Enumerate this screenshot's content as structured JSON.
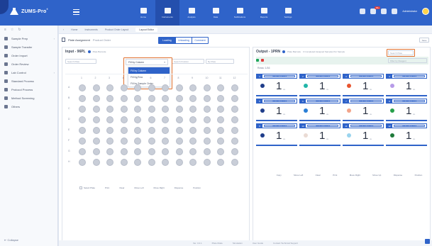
{
  "app": {
    "title": "ZUMS-Pro",
    "title_sup": "®",
    "brand_color": "#2f63c9",
    "icon": "flask-logo-icon"
  },
  "topnav": {
    "items": [
      {
        "label": "Home"
      },
      {
        "label": "Instruments"
      },
      {
        "label": "Analysis"
      },
      {
        "label": "Data"
      },
      {
        "label": "Notifications"
      },
      {
        "label": "Reports"
      },
      {
        "label": "Settings"
      }
    ],
    "active_index": 1,
    "notification_count": "99+",
    "user": "Administrator"
  },
  "sidebar": {
    "items": [
      {
        "label": "Sample Prep",
        "icon": "sample-icon"
      },
      {
        "label": "Sample Transfer"
      },
      {
        "label": "Order Import"
      },
      {
        "label": "Order Review"
      },
      {
        "label": "Lab Control"
      },
      {
        "label": "Standard Process"
      },
      {
        "label": "Protocol Process"
      },
      {
        "label": "Method Screening"
      },
      {
        "label": "Others"
      }
    ],
    "footer": "Collapse"
  },
  "breadcrumb": [
    "Home",
    "Instruments",
    "Product Order Layout",
    "Layout Editor"
  ],
  "toolbar": {
    "title": "Plate Assignment",
    "title_suffix": "Product Order",
    "seg_options": [
      "Loading",
      "Unloading",
      "Comment"
    ],
    "seg_active": 0,
    "save_label": "Save"
  },
  "input_panel": {
    "title": "Input - 96PL",
    "subtitle": "Plate Barcode",
    "filter_placeholder": "Search Plate",
    "filter2_placeholder": "Search Position",
    "filter3_placeholder": "By Plate",
    "dropdown": {
      "current": "Fill by Column",
      "options": [
        "Fill by Column",
        "Fill by Row",
        "Fill by Sample Order"
      ],
      "selected_index": 0
    },
    "columns": [
      "1",
      "2",
      "3",
      "4",
      "5",
      "6",
      "7",
      "8",
      "9",
      "10",
      "11",
      "12"
    ],
    "rows": [
      "A",
      "B",
      "C",
      "D",
      "E",
      "F",
      "G",
      "H"
    ],
    "footer": [
      "Select Plate",
      "Print",
      "Clear",
      "Move Left",
      "Move Right",
      "Dispense",
      "Position"
    ]
  },
  "output_panel": {
    "title": "Output - 1PRN",
    "subtitle": "Plate Barcode",
    "assigned_text": "3 Completed Assigned Samples Per Sample",
    "filter_placeholder": "Search Plate",
    "filter2_placeholder": "Filter by Reagent",
    "rows_label": "Rows: 1/16",
    "legend_colors": [
      "#1fa65a",
      "#e03b3b"
    ],
    "cards": [
      {
        "num": "1",
        "label": "Standard Reagent",
        "value": "1",
        "dot": "#1f3d8a"
      },
      {
        "num": "2",
        "label": "Standard Reagent",
        "value": "1",
        "dot": "#21b5a8"
      },
      {
        "num": "3",
        "label": "Standard Reagent",
        "value": "1",
        "dot": "#e8552f"
      },
      {
        "num": "4",
        "label": "Standard Reagent",
        "value": "1",
        "dot": "#b79be8"
      },
      {
        "num": "5",
        "label": "Standard Reagent",
        "value": "1",
        "dot": "#1f3d8a"
      },
      {
        "num": "6",
        "label": "Standard Reagent",
        "value": "1",
        "dot": "#2a7fd6"
      },
      {
        "num": "7",
        "label": "Standard Reagent",
        "value": "1",
        "dot": "#f2a48a"
      },
      {
        "num": "8",
        "label": "Standard Reagent",
        "value": "1",
        "dot": "#27a04a"
      },
      {
        "num": "9",
        "label": "Standard Reagent",
        "value": "1",
        "dot": "#1f3d8a"
      },
      {
        "num": "10",
        "label": "Standard Reagent",
        "value": "1",
        "dot": "#eadbd4"
      },
      {
        "num": "11",
        "label": "Standard Reagent",
        "value": "1",
        "dot": "#9ad4ee"
      },
      {
        "num": "12",
        "label": "Standard Reagent",
        "value": "1",
        "dot": "#1f7a3a"
      }
    ],
    "unit": "uL",
    "footer": [
      "Copy",
      "Move Left",
      "Clear",
      "Print",
      "Move Right",
      "Move Up",
      "Dispense",
      "Position"
    ]
  },
  "statusbar": [
    "Ver. 3.2.1",
    "Plate Mode",
    "Simulation",
    "User Guide",
    "Contact Technical Support"
  ]
}
